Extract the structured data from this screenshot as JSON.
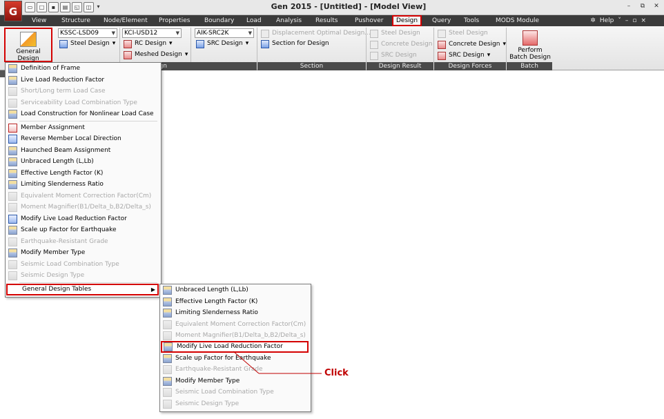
{
  "window": {
    "title": "Gen 2015 - [Untitled] - [Model View]",
    "logo_text": "G",
    "controls": [
      "–",
      "⧉",
      "✕"
    ]
  },
  "quick_access": [
    "open-icon",
    "new-icon",
    "save-icon",
    "print-icon",
    "preview-icon",
    "copy-icon",
    "dropdown-icon"
  ],
  "menubar": {
    "items": [
      "View",
      "Structure",
      "Node/Element",
      "Properties",
      "Boundary",
      "Load",
      "Analysis",
      "Results",
      "Pushover",
      "Design",
      "Query",
      "Tools",
      "MODS Module"
    ],
    "active": "Design",
    "help": "Help",
    "help_controls": [
      "˅",
      "–",
      "▫",
      "×"
    ]
  },
  "ribbon": {
    "general_design_parameter": "General Design Parameter",
    "dropdown_marker": "▾",
    "combos": {
      "steel_code": "KSSC-LSD09",
      "rc_code": "KCI-USD12",
      "src_code": "AIK-SRC2K"
    },
    "buttons": {
      "steel_design": "Steel Design",
      "rc_design": "RC Design",
      "meshed_design": "Meshed Design",
      "src_design": "SRC Design",
      "displacement_optimal": "Displacement Optimal Design...",
      "section_for_design": "Section for Design",
      "result_steel": "Steel Design",
      "result_concrete": "Concrete Design",
      "result_src": "SRC Design",
      "forces_steel": "Steel Design",
      "forces_concrete": "Concrete Design",
      "forces_src": "SRC Design",
      "perform_batch": "Perform Batch Design"
    },
    "group_labels": {
      "design": "gn",
      "section": "Section",
      "design_result": "Design Result",
      "design_forces": "Design Forces",
      "batch": "Batch"
    }
  },
  "dropdown_menu": {
    "items": [
      {
        "label": "Definition of Frame",
        "enabled": true
      },
      {
        "label": "Live Load Reduction Factor",
        "enabled": true
      },
      {
        "label": "Short/Long term Load Case",
        "enabled": false
      },
      {
        "label": "Serviceability Load Combination Type",
        "enabled": false
      },
      {
        "label": "Load Construction for Nonlinear Load Case",
        "enabled": true
      },
      {
        "label": "Member Assignment",
        "enabled": true
      },
      {
        "label": "Reverse Member Local Direction",
        "enabled": true
      },
      {
        "label": "Haunched Beam Assignment",
        "enabled": true
      },
      {
        "label": "Unbraced Length (L,Lb)",
        "enabled": true
      },
      {
        "label": "Effective Length Factor (K)",
        "enabled": true
      },
      {
        "label": "Limiting Slenderness Ratio",
        "enabled": true
      },
      {
        "label": "Equivalent Moment Correction Factor(Cm)",
        "enabled": false
      },
      {
        "label": "Moment Magnifier(B1/Delta_b,B2/Delta_s)",
        "enabled": false
      },
      {
        "label": "Modify Live Load Reduction Factor",
        "enabled": true
      },
      {
        "label": "Scale up Factor for Earthquake",
        "enabled": true
      },
      {
        "label": "Earthquake-Resistant Grade",
        "enabled": false
      },
      {
        "label": "Modify Member Type",
        "enabled": true
      },
      {
        "label": "Seismic Load Combination Type",
        "enabled": false
      },
      {
        "label": "Seismic Design Type",
        "enabled": false
      },
      {
        "label": "General Design Tables",
        "enabled": true
      }
    ]
  },
  "submenu": {
    "items": [
      {
        "label": "Unbraced Length (L,Lb)",
        "enabled": true
      },
      {
        "label": "Effective Length Factor (K)",
        "enabled": true
      },
      {
        "label": "Limiting Slenderness Ratio",
        "enabled": true
      },
      {
        "label": "Equivalent Moment Correction Factor(Cm)",
        "enabled": false
      },
      {
        "label": "Moment Magnifier(B1/Delta_b,B2/Delta_s)",
        "enabled": false
      },
      {
        "label": "Modify Live Load Reduction Factor",
        "enabled": true
      },
      {
        "label": "Scale up Factor for Earthquake",
        "enabled": true
      },
      {
        "label": "Earthquake-Resistant Grade",
        "enabled": false
      },
      {
        "label": "Modify Member Type",
        "enabled": true
      },
      {
        "label": "Seismic Load Combination Type",
        "enabled": false
      },
      {
        "label": "Seismic Design Type",
        "enabled": false
      }
    ]
  },
  "annotation": {
    "click_label": "Click"
  },
  "colors": {
    "highlight": "#d40000",
    "menubar": "#3b3b3b",
    "disabled_text": "#a8a8a8"
  }
}
